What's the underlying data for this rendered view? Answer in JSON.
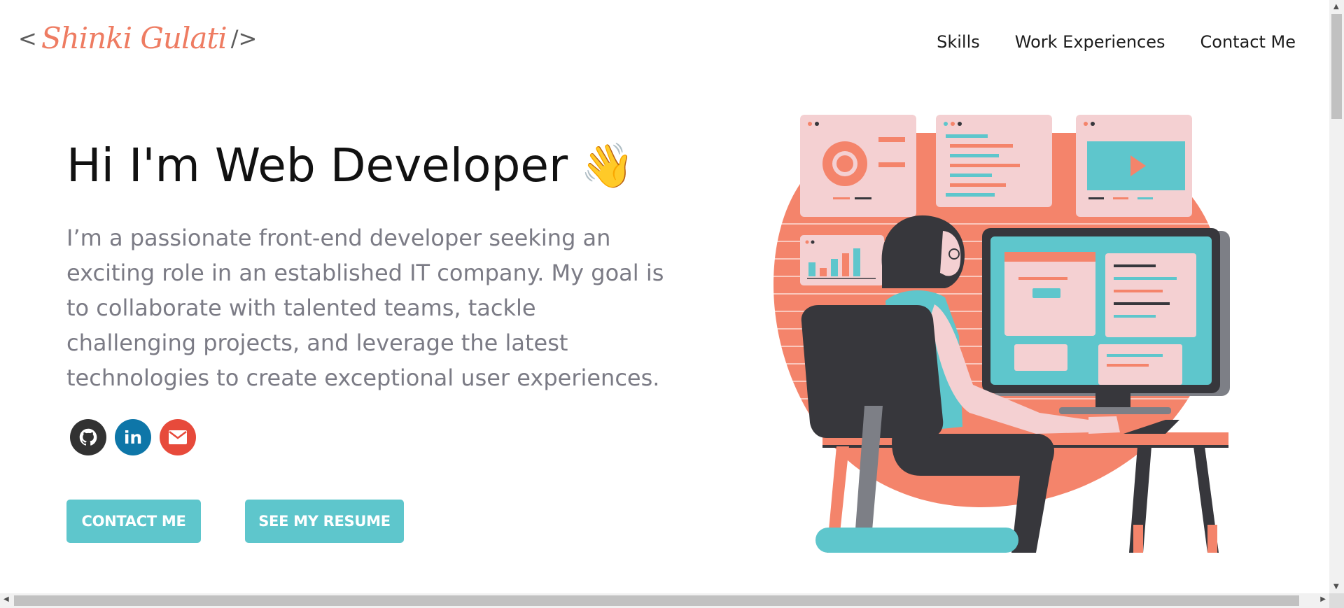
{
  "header": {
    "logo_open": "<",
    "logo_signature": "Shinki Gulati",
    "logo_close": "/>",
    "nav": [
      "Skills",
      "Work Experiences",
      "Contact Me"
    ]
  },
  "hero": {
    "title": "Hi I'm Web Developer",
    "wave_emoji": "👋",
    "description": "I’m a passionate front-end developer seeking an exciting role in an established IT company. My goal is to collaborate with talented teams, tackle challenging projects, and leverage the latest technologies to create exceptional user experiences.",
    "socials": [
      {
        "name": "github-icon",
        "color": "#323232"
      },
      {
        "name": "linkedin-icon",
        "color": "#0e76a8",
        "text": "in"
      },
      {
        "name": "email-icon",
        "color": "#e74a3b"
      }
    ],
    "buttons": {
      "contact": "CONTACT ME",
      "resume": "SEE MY RESUME"
    }
  },
  "colors": {
    "accent": "#5ec6cc",
    "coral": "#f4846b",
    "pink": "#f4d0d2",
    "dark": "#37373c"
  }
}
